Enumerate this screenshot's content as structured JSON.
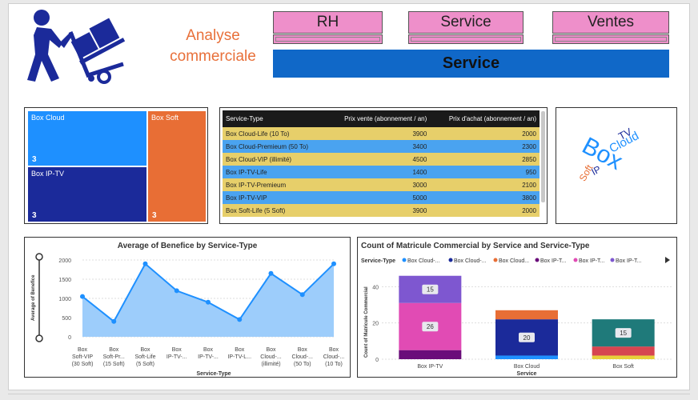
{
  "header": {
    "title_line1": "Analyse",
    "title_line2": "commerciale",
    "nav": [
      "RH",
      "Service",
      "Ventes"
    ],
    "section_title": "Service"
  },
  "treemap": {
    "cells": [
      {
        "label": "Box Cloud",
        "count": "3",
        "color": "#1e90ff"
      },
      {
        "label": "Box Soft",
        "count": "3",
        "color": "#e86e35"
      },
      {
        "label": "Box IP-TV",
        "count": "3",
        "color": "#1b2a9a"
      }
    ]
  },
  "table": {
    "headers": [
      "Service-Type",
      "Prix vente (abonnement / an)",
      "Prix d'achat (abonnement / an)"
    ],
    "rows": [
      [
        "Box Cloud-Life (10 To)",
        "3900",
        "2000"
      ],
      [
        "Box Cloud-Premieum (50 To)",
        "3400",
        "2300"
      ],
      [
        "Box Cloud-VIP (illimité)",
        "4500",
        "2850"
      ],
      [
        "Box IP-TV-Life",
        "1400",
        "950"
      ],
      [
        "Box IP-TV-Premieum",
        "3000",
        "2100"
      ],
      [
        "Box IP-TV-VIP",
        "5000",
        "3800"
      ],
      [
        "Box Soft-Life (5 Soft)",
        "3900",
        "2000"
      ]
    ],
    "row_colors": [
      "#e7cf6a",
      "#4aa3f0"
    ]
  },
  "wordcloud": {
    "words": [
      "Box",
      "Cloud",
      "TV",
      "IP",
      "Soft"
    ]
  },
  "chart_data": [
    {
      "type": "area",
      "title": "Average of Benefice by Service-Type",
      "xlabel": "Service-Type",
      "ylabel": "Average of Benefice",
      "ylim": [
        0,
        2000
      ],
      "yticks": [
        "0",
        "500",
        "1000",
        "1500",
        "2000"
      ],
      "categories": [
        [
          "Box",
          "Soft-VIP",
          "(30 Soft)"
        ],
        [
          "Box",
          "Soft-Pr...",
          "(15 Soft)"
        ],
        [
          "Box",
          "Soft-Life",
          "(5 Soft)"
        ],
        [
          "Box",
          "IP-TV-..."
        ],
        [
          "Box",
          "IP-TV-..."
        ],
        [
          "Box",
          "IP-TV-L..."
        ],
        [
          "Box",
          "Cloud-...",
          "(illimité)"
        ],
        [
          "Box",
          "Cloud-...",
          "(50 To)"
        ],
        [
          "Box",
          "Cloud-...",
          "(10 To)"
        ]
      ],
      "values": [
        1050,
        400,
        1900,
        1200,
        900,
        450,
        1650,
        1100,
        1900
      ],
      "color": "#1e90ff"
    },
    {
      "type": "bar",
      "title": "Count of Matricule Commercial by Service and Service-Type",
      "xlabel": "Service",
      "ylabel": "Count of Matricule Commercial",
      "ylim": [
        0,
        45
      ],
      "yticks": [
        "0",
        "20",
        "40"
      ],
      "legend_title": "Service-Type",
      "legend": [
        {
          "name": "Box Cloud-...",
          "color": "#1e90ff"
        },
        {
          "name": "Box Cloud-...",
          "color": "#1b2a9a"
        },
        {
          "name": "Box Cloud...",
          "color": "#e86e35"
        },
        {
          "name": "Box IP-T...",
          "color": "#6a0d7a"
        },
        {
          "name": "Box IP-T...",
          "color": "#e14bb4"
        },
        {
          "name": "Box IP-T...",
          "color": "#7e57d0"
        }
      ],
      "categories": [
        "Box IP-TV",
        "Box Cloud",
        "Box Soft"
      ],
      "stacks": [
        [
          {
            "value": 5,
            "color": "#6a0d7a"
          },
          {
            "value": 26,
            "color": "#e14bb4",
            "label": "26"
          },
          {
            "value": 15,
            "color": "#7e57d0",
            "label": "15"
          }
        ],
        [
          {
            "value": 2,
            "color": "#1e90ff"
          },
          {
            "value": 20,
            "color": "#1b2a9a",
            "label": "20"
          },
          {
            "value": 5,
            "color": "#e86e35"
          }
        ],
        [
          {
            "value": 2,
            "color": "#e7cf3a"
          },
          {
            "value": 5,
            "color": "#d64550"
          },
          {
            "value": 15,
            "color": "#1f7a7a",
            "label": "15"
          }
        ]
      ]
    }
  ]
}
